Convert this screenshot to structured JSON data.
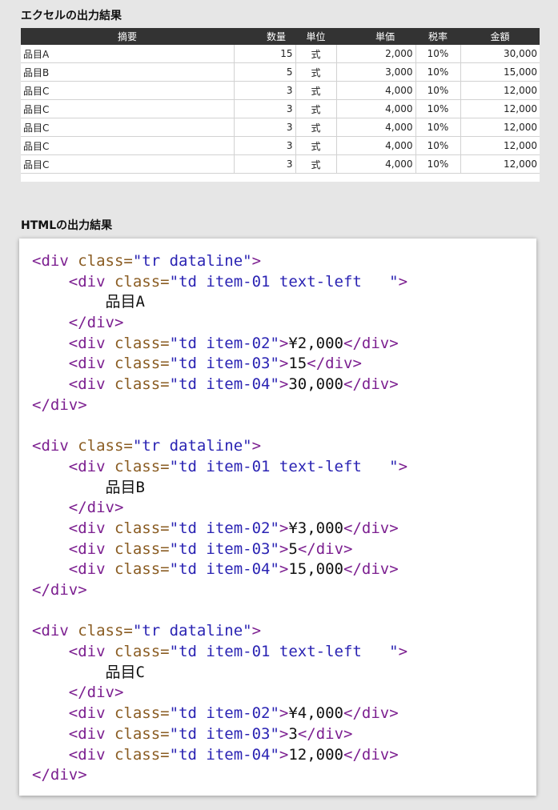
{
  "excel": {
    "title": "エクセルの出力結果",
    "headers": [
      "摘要",
      "数量",
      "単位",
      "単価",
      "税率",
      "金額"
    ],
    "rows": [
      [
        "品目A",
        "15",
        "式",
        "2,000",
        "10%",
        "30,000"
      ],
      [
        "品目B",
        "5",
        "式",
        "3,000",
        "10%",
        "15,000"
      ],
      [
        "品目C",
        "3",
        "式",
        "4,000",
        "10%",
        "12,000"
      ],
      [
        "品目C",
        "3",
        "式",
        "4,000",
        "10%",
        "12,000"
      ],
      [
        "品目C",
        "3",
        "式",
        "4,000",
        "10%",
        "12,000"
      ],
      [
        "品目C",
        "3",
        "式",
        "4,000",
        "10%",
        "12,000"
      ],
      [
        "品目C",
        "3",
        "式",
        "4,000",
        "10%",
        "12,000"
      ]
    ]
  },
  "html_output": {
    "title": "HTMLの出力結果",
    "blocks": [
      {
        "item": "品目A",
        "price": "¥2,000",
        "qty": "15",
        "amount": "30,000"
      },
      {
        "item": "品目B",
        "price": "¥3,000",
        "qty": "5",
        "amount": "15,000"
      },
      {
        "item": "品目C",
        "price": "¥4,000",
        "qty": "3",
        "amount": "12,000"
      }
    ],
    "strings": {
      "open_tag": "<div",
      "close_div": "</div>",
      "attr_class": "class=",
      "class_row": "\"tr dataline\"",
      "class_item01": "\"td item-01 text-left   \"",
      "class_item02": "\"td item-02\"",
      "class_item03": "\"td item-03\"",
      "class_item04": "\"td item-04\"",
      "gt": ">"
    }
  }
}
